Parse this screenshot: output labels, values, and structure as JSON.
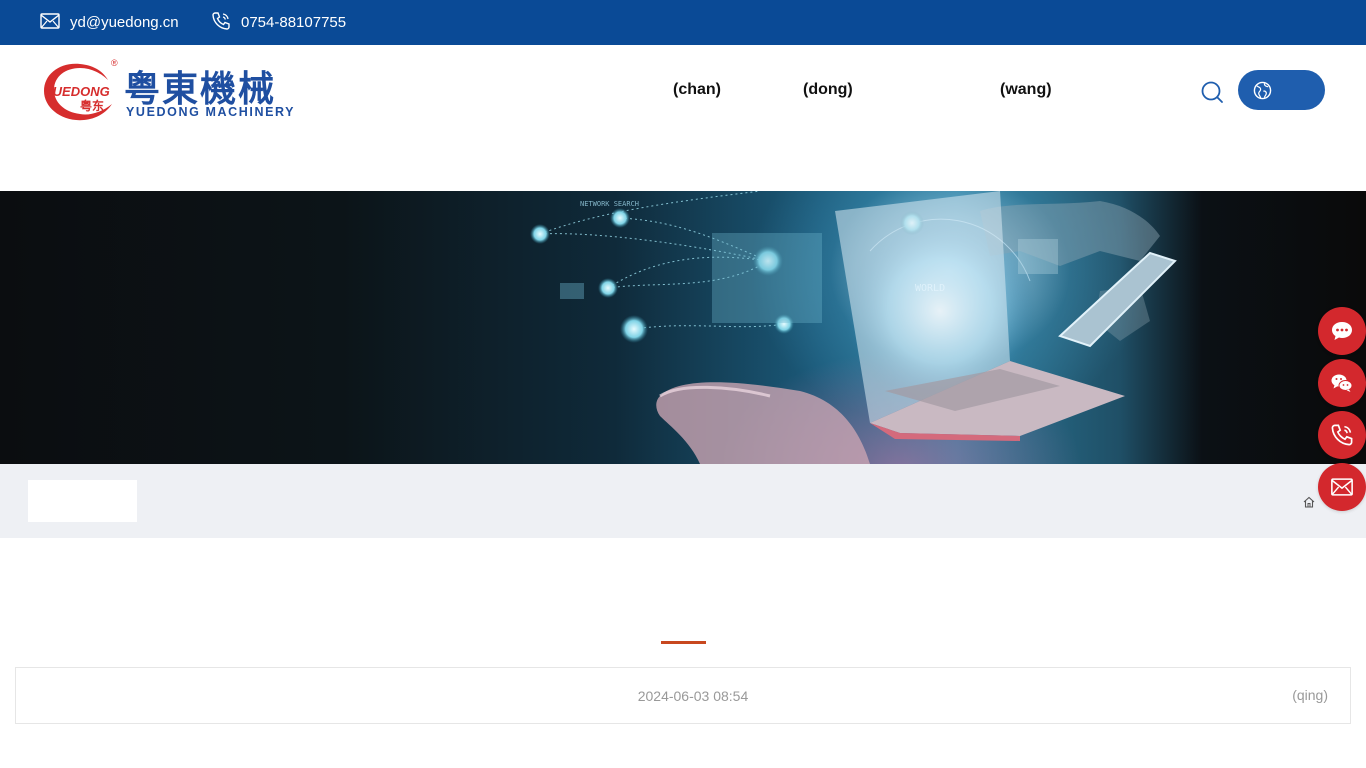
{
  "topbar": {
    "email": "yd@yuedong.cn",
    "phone": "0754-88107755",
    "icons": {
      "email": "envelope-icon",
      "phone": "phone-icon"
    }
  },
  "header": {
    "logo": {
      "brand_cn": "粤東機械",
      "brand_en": "YUEDONG MACHINERY",
      "emblem_text": "YUEDONG",
      "emblem_text_cn": "粤东",
      "registered_mark": "®"
    },
    "nav": [
      {
        "label": "(chan)"
      },
      {
        "label": "(dong)"
      },
      {
        "label": "(wang)"
      }
    ],
    "search_icon": "search-icon",
    "language_icon": "globe-icon"
  },
  "banner": {
    "image": "laptop-world-network-banner"
  },
  "breadcrumb": {
    "home_icon": "home-icon"
  },
  "side_buttons": [
    {
      "icon": "chat-bubble-icon"
    },
    {
      "icon": "wechat-icon"
    },
    {
      "icon": "phone-icon"
    },
    {
      "icon": "envelope-icon"
    }
  ],
  "article": {
    "date": "2024-06-03 08:54",
    "right_text": "(qing)"
  },
  "colors": {
    "topbar_bg": "#0a4a96",
    "brand_blue": "#1f4fa1",
    "accent_red": "#d3282d",
    "accent_orange": "#c8481f",
    "strip_bg": "#eef0f4"
  }
}
